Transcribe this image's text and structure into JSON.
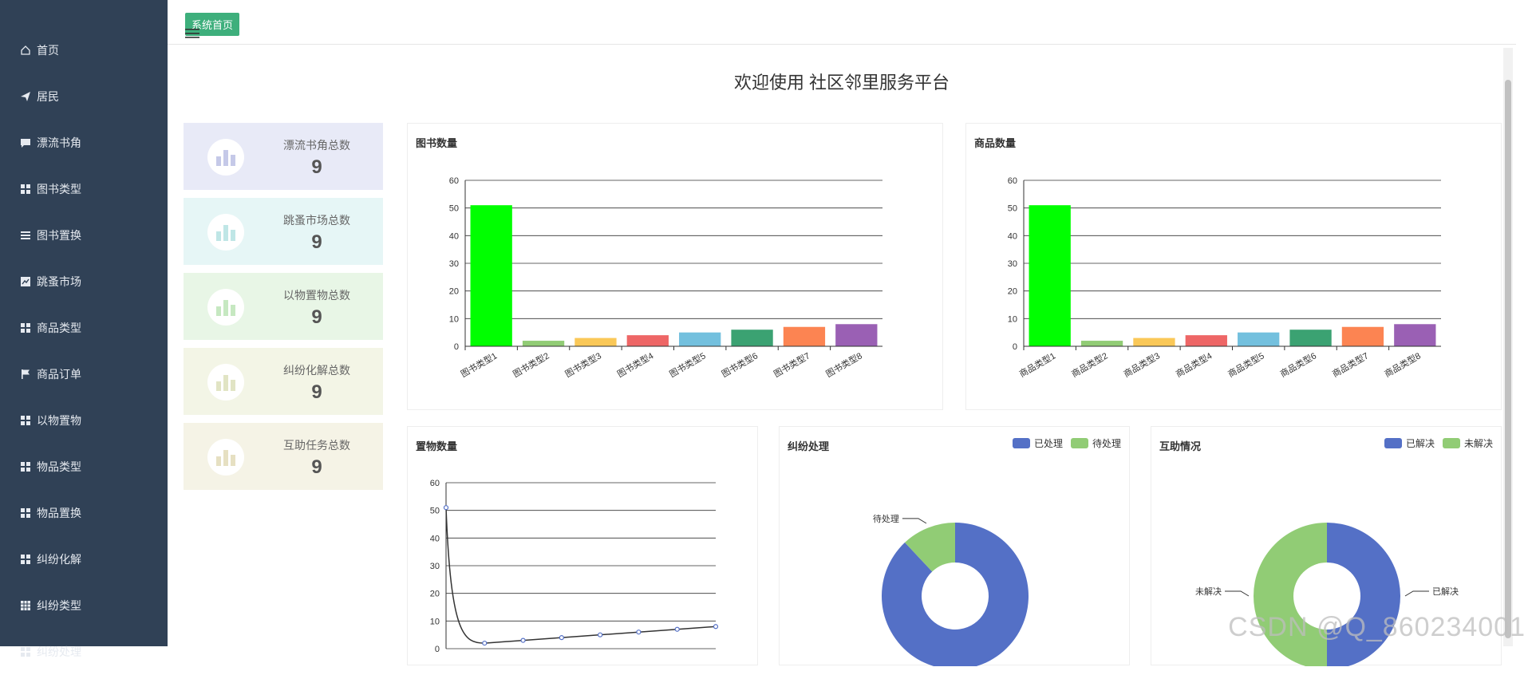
{
  "sidebar": {
    "items": [
      {
        "label": "首页",
        "icon": "home-icon"
      },
      {
        "label": "居民",
        "icon": "send-icon"
      },
      {
        "label": "漂流书角",
        "icon": "chat-icon"
      },
      {
        "label": "图书类型",
        "icon": "grid-icon"
      },
      {
        "label": "图书置换",
        "icon": "list-icon"
      },
      {
        "label": "跳蚤市场",
        "icon": "chart-icon"
      },
      {
        "label": "商品类型",
        "icon": "grid-icon"
      },
      {
        "label": "商品订单",
        "icon": "flag-icon"
      },
      {
        "label": "以物置物",
        "icon": "grid-icon"
      },
      {
        "label": "物品类型",
        "icon": "grid-icon"
      },
      {
        "label": "物品置换",
        "icon": "grid-icon"
      },
      {
        "label": "纠纷化解",
        "icon": "grid-icon"
      },
      {
        "label": "纠纷类型",
        "icon": "table-icon"
      },
      {
        "label": "纠纷处理",
        "icon": "grid-icon"
      }
    ]
  },
  "header": {
    "crumb": "系统首页"
  },
  "welcome": "欢迎使用 社区邻里服务平台",
  "stats": [
    {
      "label": "漂流书角总数",
      "value": "9",
      "bg": "#e8eaf7",
      "bar": "#c5c9e8"
    },
    {
      "label": "跳蚤市场总数",
      "value": "9",
      "bg": "#e6f6f6",
      "bar": "#bfe6e6"
    },
    {
      "label": "以物置物总数",
      "value": "9",
      "bg": "#e8f6e6",
      "bar": "#c6e8c1"
    },
    {
      "label": "纠纷化解总数",
      "value": "9",
      "bg": "#f3f5e6",
      "bar": "#e1e4c4"
    },
    {
      "label": "互助任务总数",
      "value": "9",
      "bg": "#f5f3e6",
      "bar": "#e6e0c2"
    }
  ],
  "watermark": "CSDN @Q_860234001",
  "chart_data": [
    {
      "type": "bar",
      "title": "图书数量",
      "categories": [
        "图书类型1",
        "图书类型2",
        "图书类型3",
        "图书类型4",
        "图书类型5",
        "图书类型6",
        "图书类型7",
        "图书类型8"
      ],
      "values": [
        51,
        2,
        3,
        4,
        5,
        6,
        7,
        8
      ],
      "colors": [
        "#00ff00",
        "#91cc75",
        "#fac858",
        "#ee6666",
        "#73c0de",
        "#3ba272",
        "#fc8452",
        "#9a60b4"
      ],
      "ylim": [
        0,
        60
      ],
      "yticks": [
        0,
        10,
        20,
        30,
        40,
        50,
        60
      ]
    },
    {
      "type": "bar",
      "title": "商品数量",
      "categories": [
        "商品类型1",
        "商品类型2",
        "商品类型3",
        "商品类型4",
        "商品类型5",
        "商品类型6",
        "商品类型7",
        "商品类型8"
      ],
      "values": [
        51,
        2,
        3,
        4,
        5,
        6,
        7,
        8
      ],
      "colors": [
        "#00ff00",
        "#91cc75",
        "#fac858",
        "#ee6666",
        "#73c0de",
        "#3ba272",
        "#fc8452",
        "#9a60b4"
      ],
      "ylim": [
        0,
        60
      ],
      "yticks": [
        0,
        10,
        20,
        30,
        40,
        50,
        60
      ]
    },
    {
      "type": "line",
      "title": "置物数量",
      "values": [
        51,
        2,
        3,
        4,
        5,
        6,
        7,
        8
      ],
      "ylim": [
        0,
        60
      ],
      "yticks": [
        0,
        10,
        20,
        30,
        40,
        50,
        60
      ]
    },
    {
      "type": "pie",
      "title": "纠纷处理",
      "legend": [
        "已处理",
        "待处理"
      ],
      "values": [
        88,
        12
      ],
      "colors": [
        "#5470c6",
        "#91cc75"
      ],
      "labels": [
        "",
        "待处理"
      ]
    },
    {
      "type": "pie",
      "title": "互助情况",
      "legend": [
        "已解决",
        "未解决"
      ],
      "values": [
        50,
        50
      ],
      "colors": [
        "#5470c6",
        "#91cc75"
      ],
      "labels": [
        "已解决",
        "未解决"
      ]
    }
  ]
}
